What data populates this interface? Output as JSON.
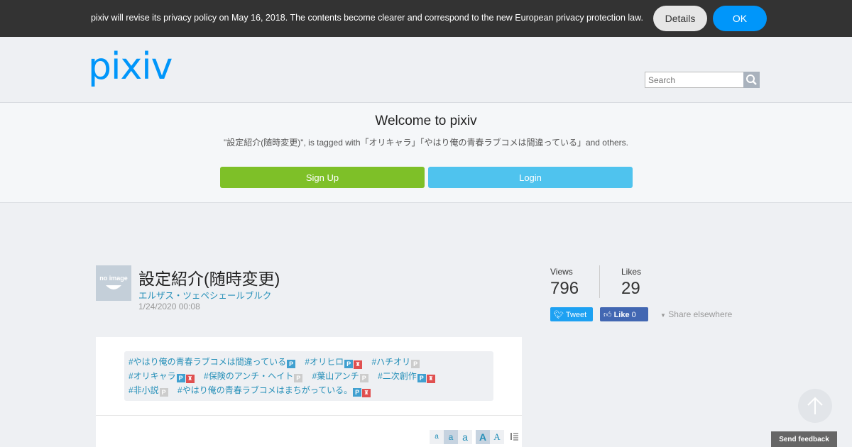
{
  "notice": {
    "text": "pixiv will revise its privacy policy on May 16, 2018. The contents become clearer and correspond to the new European privacy protection law.",
    "details_label": "Details",
    "ok_label": "OK"
  },
  "header": {
    "logo": "pixiv",
    "search_placeholder": "Search"
  },
  "welcome": {
    "title": "Welcome to pixiv",
    "description": "\"設定紹介(随時変更)\", is tagged with「オリキャラ」「やはり俺の青春ラブコメは間違っている」and others.",
    "signup_label": "Sign Up",
    "login_label": "Login"
  },
  "work": {
    "avatar_text": "no image",
    "title": "設定紹介(随時変更)",
    "author": "エルザス・ツェペシェールブルク",
    "date": "1/24/2020 00:08"
  },
  "stats": {
    "views_label": "Views",
    "views_value": "796",
    "likes_label": "Likes",
    "likes_value": "29"
  },
  "share": {
    "tweet_label": "Tweet",
    "like_label": "Like",
    "like_count": "0",
    "elsewhere_label": "Share elsewhere"
  },
  "tags": [
    {
      "label": "#やはり俺の青春ラブコメは間違っている",
      "badges": [
        "p-blue"
      ]
    },
    {
      "label": "#オリヒロ",
      "badges": [
        "p-blue",
        "red"
      ]
    },
    {
      "label": "#ハチオリ",
      "badges": [
        "p-grey"
      ]
    },
    {
      "label": "#オリキャラ",
      "badges": [
        "p-blue",
        "red"
      ]
    },
    {
      "label": "#保険のアンチ・ヘイト",
      "badges": [
        "p-grey"
      ]
    },
    {
      "label": "#葉山アンチ",
      "badges": [
        "p-grey"
      ]
    },
    {
      "label": "#二次創作",
      "badges": [
        "p-blue",
        "red"
      ]
    },
    {
      "label": "#非小説",
      "badges": [
        "p-grey"
      ]
    },
    {
      "label": "#やはり俺の青春ラブコメはまちがっている。",
      "badges": [
        "p-blue",
        "red"
      ]
    }
  ],
  "font_size_buttons": [
    "a",
    "a",
    "a",
    "A",
    "A"
  ],
  "feedback_label": "Send feedback",
  "colors": {
    "brand": "#0096fa",
    "signup": "#7ec028",
    "login": "#4fc3ee",
    "link": "#258fb8"
  }
}
